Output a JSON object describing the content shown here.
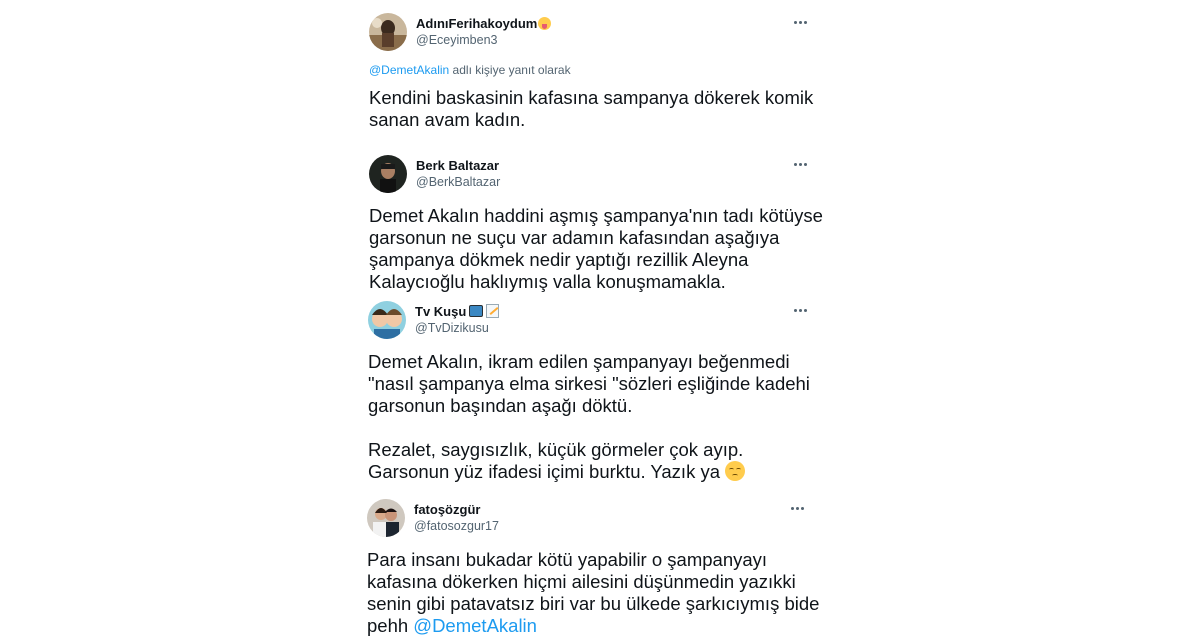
{
  "tweets": [
    {
      "display_name": "AdınıFerihakoydum",
      "name_emoji": "tongue-wink-emoji",
      "handle": "@Eceyimben3",
      "reply_mention": "@DemetAkalin",
      "reply_suffix": " adlı kişiye yanıt olarak",
      "text": "Kendini baskasinin kafasına sampanya dökerek komik\nsanan avam kadın."
    },
    {
      "display_name": "Berk Baltazar",
      "handle": "@BerkBaltazar",
      "text": "Demet Akalın haddini aşmış şampanya'nın tadı kötüyse\ngarsonun ne suçu var adamın kafasından aşağıya\nşampanya dökmek nedir yaptığı rezillik Aleyna\nKalaycıoğlu haklıymış valla konuşmamakla."
    },
    {
      "display_name": "Tv Kuşu",
      "name_emojis": [
        "tv-emoji",
        "memo-emoji"
      ],
      "handle": "@TvDizikusu",
      "text": "Demet Akalın, ikram edilen şampanyayı beğenmedi\n\"nasıl şampanya elma sirkesi \"sözleri eşliğinde kadehi\ngarsonun başından aşağı döktü.\n\nRezalet, saygısızlık, küçük görmeler çok ayıp.\n Garsonun yüz ifadesi içimi burktu. Yazık ya",
      "text_emoji": "pensive-face-emoji"
    },
    {
      "display_name": "fatoşözgür",
      "handle": "@fatosozgur17",
      "text": "Para insanı bukadar kötü yapabilir o şampanyayı\nkafasına dökerken hiçmi ailesini düşünmedin yazıkki\nsenin gibi patavatsız biri var bu ülkede şarkıcıymış bide\npehh ",
      "text_mention": "@DemetAkalin"
    }
  ],
  "colors": {
    "accent": "#1d9bf0",
    "text": "#0f1419",
    "secondary": "#536471"
  },
  "icons": {
    "more": "more-dots-icon"
  }
}
